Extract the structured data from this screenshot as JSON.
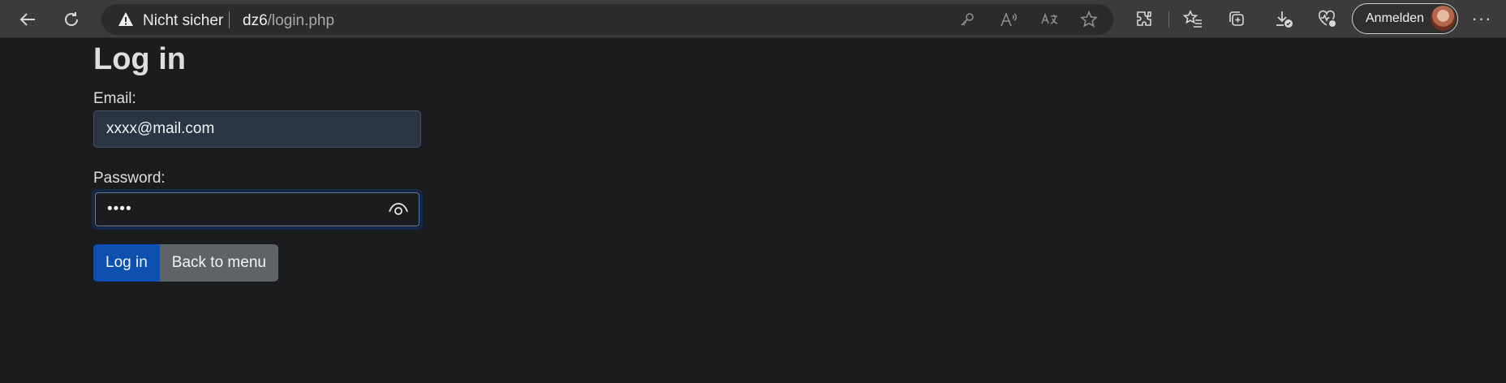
{
  "browser": {
    "security_label": "Nicht sicher",
    "url_host": "dz6",
    "url_path": "/login.php",
    "signin_label": "Anmelden",
    "more_label": "···",
    "icons": [
      "back-arrow-icon",
      "refresh-icon",
      "warning-icon",
      "key-icon",
      "read-aloud-icon",
      "translate-icon",
      "favorite-star-icon",
      "extensions-icon",
      "favorites-list-icon",
      "collections-icon",
      "downloads-icon",
      "browser-essentials-icon",
      "avatar",
      "more-icon"
    ]
  },
  "page": {
    "title": "Log in",
    "email_label": "Email:",
    "email_value": "xxxx@mail.com",
    "password_label": "Password:",
    "password_value": "••••",
    "login_button": "Log in",
    "back_button": "Back to menu"
  },
  "colors": {
    "page_background": "#1b1c1e",
    "browser_toolbar": "#3b3b3c",
    "primary_button": "#0d50b0",
    "secondary_button": "#5f6367",
    "email_input_background": "#2b3443",
    "focus_ring": "#122a4e"
  }
}
